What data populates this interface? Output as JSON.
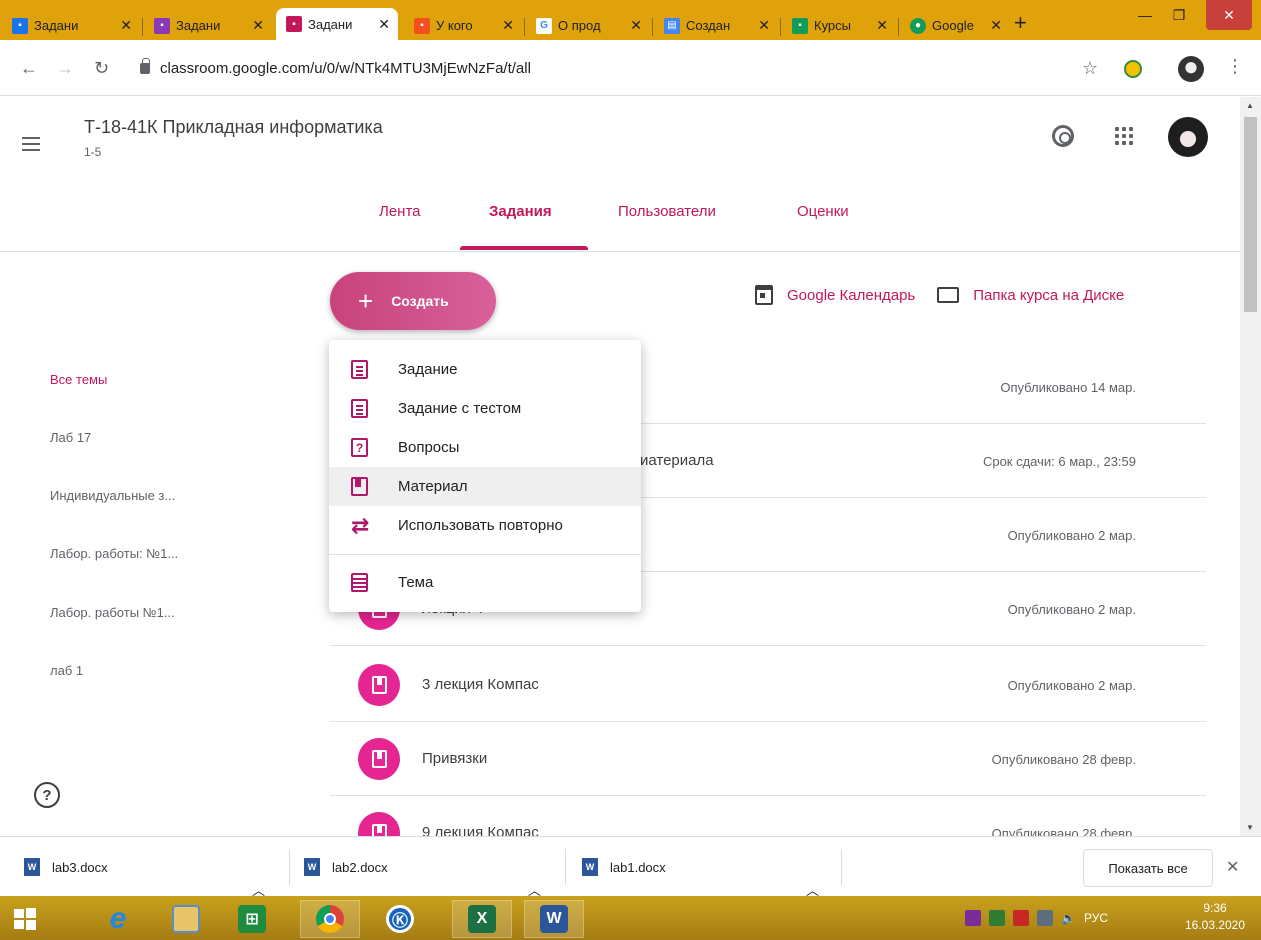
{
  "browser": {
    "tabs": [
      {
        "title": "Задани",
        "favicon_color": "#1a73e8",
        "active": false
      },
      {
        "title": "Задани",
        "favicon_color": "#8a3ab9",
        "active": false
      },
      {
        "title": "Задани",
        "favicon_color": "#c2185b",
        "active": true
      },
      {
        "title": "У кого",
        "favicon_color": "#f4511e",
        "active": false
      },
      {
        "title": "О прод",
        "favicon_color": "#ffffff",
        "active": false
      },
      {
        "title": "Создан",
        "favicon_color": "#4285f4",
        "active": false
      },
      {
        "title": "Курсы",
        "favicon_color": "#0f9d58",
        "active": false
      },
      {
        "title": "Google",
        "favicon_color": "#0f9d58",
        "active": false
      }
    ],
    "new_tab_label": "+",
    "url": "classroom.google.com/u/0/w/NTk4MTU3MjEwNzFa/t/all"
  },
  "course": {
    "title": "Т-18-41К Прикладная информатика",
    "section": "1-5"
  },
  "nav_tabs": [
    {
      "label": "Лента",
      "active": false
    },
    {
      "label": "Задания",
      "active": true
    },
    {
      "label": "Пользователи",
      "active": false
    },
    {
      "label": "Оценки",
      "active": false
    }
  ],
  "actions": {
    "create_label": "Создать",
    "calendar_label": "Google Календарь",
    "drive_folder_label": "Папка курса на Диске"
  },
  "topics": [
    {
      "label": "Все темы",
      "active": true
    },
    {
      "label": "Лаб 17",
      "active": false
    },
    {
      "label": "Индивидуальные з...",
      "active": false
    },
    {
      "label": "Лабор. работы: №1...",
      "active": false
    },
    {
      "label": "Лабор. работы №1...",
      "active": false
    },
    {
      "label": "лаб 1",
      "active": false
    }
  ],
  "create_menu": [
    {
      "label": "Задание",
      "icon": "assignment-icon"
    },
    {
      "label": "Задание с тестом",
      "icon": "quiz-assignment-icon"
    },
    {
      "label": "Вопросы",
      "icon": "question-icon"
    },
    {
      "label": "Материал",
      "icon": "material-icon",
      "highlighted": true
    },
    {
      "label": "Использовать повторно",
      "icon": "reuse-icon"
    },
    {
      "label": "Тема",
      "icon": "topic-icon"
    }
  ],
  "stream": [
    {
      "title": "",
      "meta": "Опубликовано 14 мар."
    },
    {
      "title": "иатериала",
      "meta": "Срок сдачи: 6 мар., 23:59"
    },
    {
      "title": "",
      "meta": "Опубликовано 2 мар."
    },
    {
      "title": "лекция 4",
      "meta": "Опубликовано 2 мар."
    },
    {
      "title": "3 лекция Компас",
      "meta": "Опубликовано 2 мар."
    },
    {
      "title": "Привязки",
      "meta": "Опубликовано 28 февр."
    },
    {
      "title": "9 лекция Компас",
      "meta": "Опубликовано 28 февр."
    }
  ],
  "downloads": {
    "files": [
      "lab3.docx",
      "lab2.docx",
      "lab1.docx"
    ],
    "show_all_label": "Показать все"
  },
  "taskbar": {
    "lang": "РУС",
    "time": "9:36",
    "date": "16.03.2020"
  },
  "colors": {
    "accent": "#c2185b",
    "material_circle": "#e52592",
    "chrome_frame": "#dfa20a"
  }
}
